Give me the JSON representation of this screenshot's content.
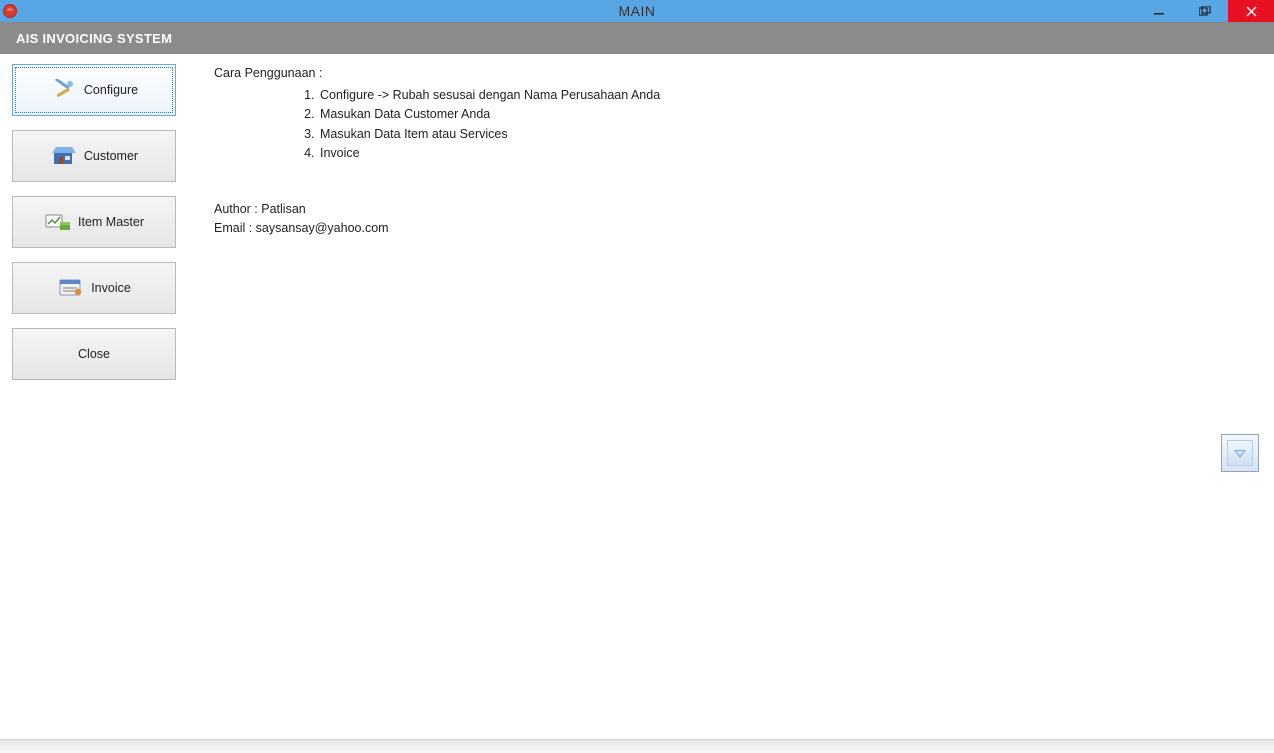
{
  "titlebar": {
    "title": "MAIN"
  },
  "subheader": {
    "title": "AIS INVOICING SYSTEM"
  },
  "sidebar": {
    "items": [
      {
        "label": "Configure"
      },
      {
        "label": "Customer"
      },
      {
        "label": "Item Master"
      },
      {
        "label": "Invoice"
      },
      {
        "label": "Close"
      }
    ]
  },
  "content": {
    "heading": "Cara Penggunaan :",
    "steps": [
      "Configure -> Rubah sesusai dengan Nama Perusahaan Anda",
      "Masukan Data Customer Anda",
      "Masukan Data Item atau Services",
      "Invoice"
    ],
    "author_line": "Author : Patlisan",
    "email_line": "Email : saysansay@yahoo.com"
  }
}
